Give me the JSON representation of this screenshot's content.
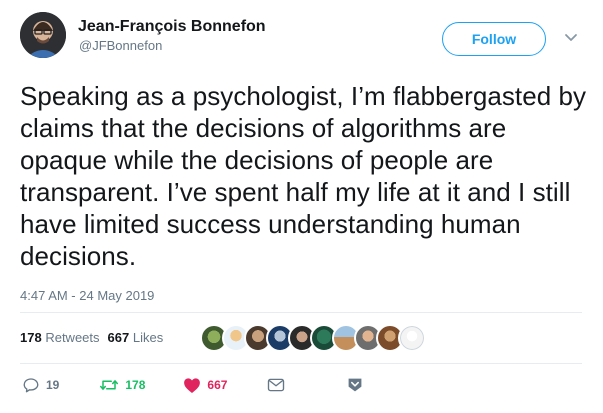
{
  "user": {
    "name": "Jean-François Bonnefon",
    "handle": "@JFBonnefon"
  },
  "follow_button": {
    "label": "Follow"
  },
  "tweet": {
    "text": "Speaking as a psychologist, I’m flabbergasted by claims that the decisions of algorithms are opaque while the decisions of people are transparent. I’ve spent half my life at it and I still have limited success understanding human decisions.",
    "timestamp": "4:47 AM - 24 May 2019"
  },
  "stats": {
    "retweets_count": "178",
    "retweets_label": "Retweets",
    "likes_count": "667",
    "likes_label": "Likes"
  },
  "actions": {
    "reply_count": "19",
    "retweet_count": "178",
    "like_count": "667"
  },
  "colors": {
    "accent": "#1da1f2",
    "retweet": "#17bf63",
    "like": "#e0245e",
    "muted": "#657786"
  },
  "icons": {
    "caret": "chevron-down-icon",
    "reply": "reply-icon",
    "retweet": "retweet-icon",
    "like": "heart-icon",
    "message": "message-icon",
    "bookmark": "bookmark-icon"
  }
}
